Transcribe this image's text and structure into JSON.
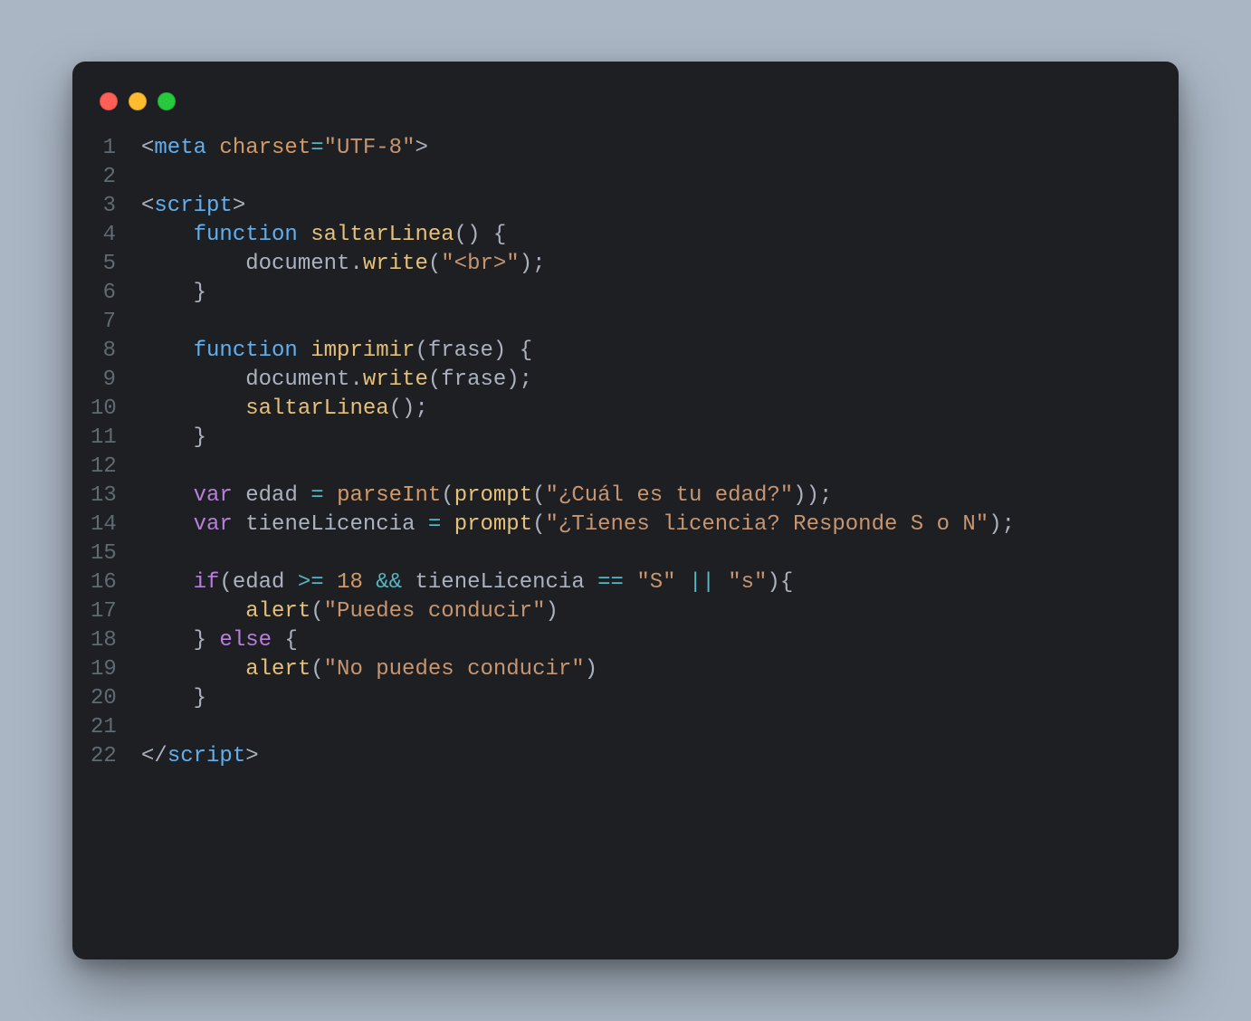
{
  "window": {
    "traffic_light_colors": {
      "close": "#ff5f56",
      "minimize": "#ffbd2e",
      "zoom": "#27c93f"
    }
  },
  "code": {
    "lines": [
      {
        "n": 1,
        "tokens": [
          [
            "punct",
            "<"
          ],
          [
            "tag",
            "meta"
          ],
          [
            "punct",
            " "
          ],
          [
            "attr",
            "charset"
          ],
          [
            "op",
            "="
          ],
          [
            "str",
            "\"UTF-8\""
          ],
          [
            "punct",
            ">"
          ]
        ]
      },
      {
        "n": 2,
        "tokens": []
      },
      {
        "n": 3,
        "tokens": [
          [
            "punct",
            "<"
          ],
          [
            "tag",
            "script"
          ],
          [
            "punct",
            ">"
          ]
        ]
      },
      {
        "n": 4,
        "tokens": [
          [
            "default",
            "    "
          ],
          [
            "kw-blue",
            "function"
          ],
          [
            "default",
            " "
          ],
          [
            "fn",
            "saltarLinea"
          ],
          [
            "punct",
            "()"
          ],
          [
            "default",
            " "
          ],
          [
            "punct",
            "{"
          ]
        ]
      },
      {
        "n": 5,
        "tokens": [
          [
            "default",
            "        "
          ],
          [
            "ident",
            "document"
          ],
          [
            "punct",
            "."
          ],
          [
            "fn",
            "write"
          ],
          [
            "punct",
            "("
          ],
          [
            "str",
            "\"<br>\""
          ],
          [
            "punct",
            ");"
          ]
        ]
      },
      {
        "n": 6,
        "tokens": [
          [
            "default",
            "    "
          ],
          [
            "punct",
            "}"
          ]
        ]
      },
      {
        "n": 7,
        "tokens": []
      },
      {
        "n": 8,
        "tokens": [
          [
            "default",
            "    "
          ],
          [
            "kw-blue",
            "function"
          ],
          [
            "default",
            " "
          ],
          [
            "fn",
            "imprimir"
          ],
          [
            "punct",
            "("
          ],
          [
            "param",
            "frase"
          ],
          [
            "punct",
            ")"
          ],
          [
            "default",
            " "
          ],
          [
            "punct",
            "{"
          ]
        ]
      },
      {
        "n": 9,
        "tokens": [
          [
            "default",
            "        "
          ],
          [
            "ident",
            "document"
          ],
          [
            "punct",
            "."
          ],
          [
            "fn",
            "write"
          ],
          [
            "punct",
            "("
          ],
          [
            "ident",
            "frase"
          ],
          [
            "punct",
            ");"
          ]
        ]
      },
      {
        "n": 10,
        "tokens": [
          [
            "default",
            "        "
          ],
          [
            "fn",
            "saltarLinea"
          ],
          [
            "punct",
            "();"
          ]
        ]
      },
      {
        "n": 11,
        "tokens": [
          [
            "default",
            "    "
          ],
          [
            "punct",
            "}"
          ]
        ]
      },
      {
        "n": 12,
        "tokens": []
      },
      {
        "n": 13,
        "tokens": [
          [
            "default",
            "    "
          ],
          [
            "kw-purp",
            "var"
          ],
          [
            "default",
            " "
          ],
          [
            "ident",
            "edad"
          ],
          [
            "default",
            " "
          ],
          [
            "op",
            "="
          ],
          [
            "default",
            " "
          ],
          [
            "fn2",
            "parseInt"
          ],
          [
            "punct",
            "("
          ],
          [
            "fn",
            "prompt"
          ],
          [
            "punct",
            "("
          ],
          [
            "str",
            "\"¿Cuál es tu edad?\""
          ],
          [
            "punct",
            "));"
          ]
        ]
      },
      {
        "n": 14,
        "tokens": [
          [
            "default",
            "    "
          ],
          [
            "kw-purp",
            "var"
          ],
          [
            "default",
            " "
          ],
          [
            "ident",
            "tieneLicencia"
          ],
          [
            "default",
            " "
          ],
          [
            "op",
            "="
          ],
          [
            "default",
            " "
          ],
          [
            "fn",
            "prompt"
          ],
          [
            "punct",
            "("
          ],
          [
            "str",
            "\"¿Tienes licencia? Responde S o N\""
          ],
          [
            "punct",
            ");"
          ]
        ]
      },
      {
        "n": 15,
        "tokens": []
      },
      {
        "n": 16,
        "tokens": [
          [
            "default",
            "    "
          ],
          [
            "kw-purp",
            "if"
          ],
          [
            "punct",
            "("
          ],
          [
            "ident",
            "edad"
          ],
          [
            "default",
            " "
          ],
          [
            "op",
            ">="
          ],
          [
            "default",
            " "
          ],
          [
            "num",
            "18"
          ],
          [
            "default",
            " "
          ],
          [
            "op",
            "&&"
          ],
          [
            "default",
            " "
          ],
          [
            "ident",
            "tieneLicencia"
          ],
          [
            "default",
            " "
          ],
          [
            "op",
            "=="
          ],
          [
            "default",
            " "
          ],
          [
            "str",
            "\"S\""
          ],
          [
            "default",
            " "
          ],
          [
            "op",
            "||"
          ],
          [
            "default",
            " "
          ],
          [
            "str",
            "\"s\""
          ],
          [
            "punct",
            "){"
          ]
        ]
      },
      {
        "n": 17,
        "tokens": [
          [
            "default",
            "        "
          ],
          [
            "fn",
            "alert"
          ],
          [
            "punct",
            "("
          ],
          [
            "str",
            "\"Puedes conducir\""
          ],
          [
            "punct",
            ")"
          ]
        ]
      },
      {
        "n": 18,
        "tokens": [
          [
            "default",
            "    "
          ],
          [
            "punct",
            "}"
          ],
          [
            "default",
            " "
          ],
          [
            "kw-purp",
            "else"
          ],
          [
            "default",
            " "
          ],
          [
            "punct",
            "{"
          ]
        ]
      },
      {
        "n": 19,
        "tokens": [
          [
            "default",
            "        "
          ],
          [
            "fn",
            "alert"
          ],
          [
            "punct",
            "("
          ],
          [
            "str",
            "\"No puedes conducir\""
          ],
          [
            "punct",
            ")"
          ]
        ]
      },
      {
        "n": 20,
        "tokens": [
          [
            "default",
            "    "
          ],
          [
            "punct",
            "}"
          ]
        ]
      },
      {
        "n": 21,
        "tokens": []
      },
      {
        "n": 22,
        "tokens": [
          [
            "punct",
            "</"
          ],
          [
            "tag",
            "script"
          ],
          [
            "punct",
            ">"
          ]
        ]
      }
    ]
  }
}
